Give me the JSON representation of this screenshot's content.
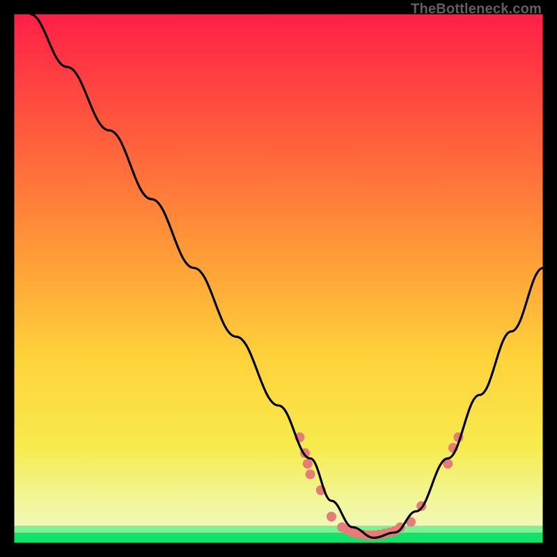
{
  "watermark": "TheBottleneck.com",
  "chart_data": {
    "type": "line",
    "title": "",
    "xlabel": "",
    "ylabel": "",
    "xlim": [
      0,
      100
    ],
    "ylim": [
      0,
      100
    ],
    "gradient": {
      "top_color": "#ff1f47",
      "mid_colors": [
        "#ff7a3a",
        "#ffd03a",
        "#f8f25a"
      ],
      "bottom_band_color": "#10e36a"
    },
    "series": [
      {
        "name": "curve",
        "description": "V-shaped bottleneck curve, high on left, dips near bottom around x≈65-72, rises again toward right",
        "points": [
          {
            "x": 3,
            "y": 100
          },
          {
            "x": 10,
            "y": 90
          },
          {
            "x": 18,
            "y": 78
          },
          {
            "x": 26,
            "y": 65
          },
          {
            "x": 34,
            "y": 52
          },
          {
            "x": 42,
            "y": 39
          },
          {
            "x": 50,
            "y": 26
          },
          {
            "x": 56,
            "y": 16
          },
          {
            "x": 60,
            "y": 8
          },
          {
            "x": 64,
            "y": 3
          },
          {
            "x": 68,
            "y": 1
          },
          {
            "x": 72,
            "y": 2
          },
          {
            "x": 76,
            "y": 6
          },
          {
            "x": 82,
            "y": 16
          },
          {
            "x": 88,
            "y": 28
          },
          {
            "x": 94,
            "y": 40
          },
          {
            "x": 100,
            "y": 52
          }
        ]
      },
      {
        "name": "markers",
        "description": "coral/pink dot cluster near trough and rising arms",
        "color": "#e87a77",
        "points": [
          {
            "x": 54,
            "y": 20
          },
          {
            "x": 55,
            "y": 17
          },
          {
            "x": 55.5,
            "y": 15
          },
          {
            "x": 56,
            "y": 13
          },
          {
            "x": 58,
            "y": 10
          },
          {
            "x": 60,
            "y": 5
          },
          {
            "x": 62,
            "y": 3
          },
          {
            "x": 63,
            "y": 2.5
          },
          {
            "x": 64,
            "y": 2
          },
          {
            "x": 65,
            "y": 1.8
          },
          {
            "x": 66,
            "y": 1.6
          },
          {
            "x": 67,
            "y": 1.5
          },
          {
            "x": 68,
            "y": 1.5
          },
          {
            "x": 69,
            "y": 1.6
          },
          {
            "x": 70,
            "y": 1.8
          },
          {
            "x": 71,
            "y": 2.0
          },
          {
            "x": 72,
            "y": 2.3
          },
          {
            "x": 73,
            "y": 3
          },
          {
            "x": 75,
            "y": 4
          },
          {
            "x": 77,
            "y": 7
          },
          {
            "x": 82,
            "y": 15
          },
          {
            "x": 83,
            "y": 18
          },
          {
            "x": 84,
            "y": 20
          }
        ]
      }
    ]
  }
}
